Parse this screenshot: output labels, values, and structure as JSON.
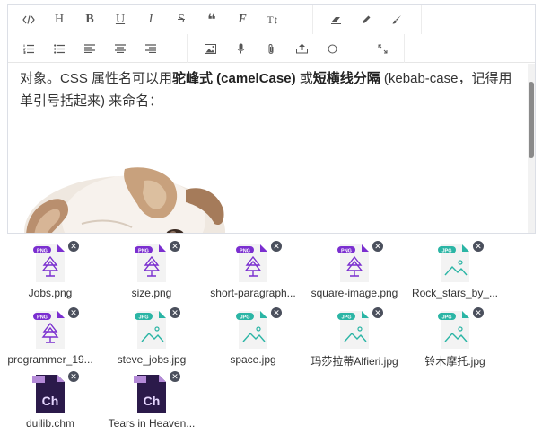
{
  "editor": {
    "toolbar_row1": [
      {
        "name": "code-icon",
        "glyph": "</>"
      },
      {
        "name": "heading-icon",
        "glyph": "H"
      },
      {
        "name": "bold-icon",
        "glyph": "B"
      },
      {
        "name": "underline-icon",
        "glyph": "U"
      },
      {
        "name": "italic-icon",
        "glyph": "I"
      },
      {
        "name": "strikethrough-icon",
        "glyph": "S"
      },
      {
        "name": "quote-icon",
        "glyph": "❝"
      },
      {
        "name": "font-family-icon",
        "glyph": "F"
      },
      {
        "name": "line-height-icon",
        "glyph": "T↕"
      },
      {
        "name": "eraser-icon",
        "glyph": ""
      },
      {
        "name": "pencil-icon",
        "glyph": ""
      },
      {
        "name": "brush-icon",
        "glyph": ""
      }
    ],
    "toolbar_row2": [
      {
        "name": "ordered-list-icon"
      },
      {
        "name": "unordered-list-icon"
      },
      {
        "name": "align-left-icon"
      },
      {
        "name": "align-center-icon"
      },
      {
        "name": "align-right-icon"
      },
      {
        "name": "image-icon"
      },
      {
        "name": "microphone-icon"
      },
      {
        "name": "attachment-icon"
      },
      {
        "name": "upload-icon"
      },
      {
        "name": "circle-icon"
      },
      {
        "name": "fullscreen-icon"
      }
    ],
    "content": {
      "text_a": "对象。CSS 属性名可以用",
      "bold_a": "驼峰式 (camelCase)",
      "text_b": " 或",
      "bold_b": "短横线分隔",
      "text_c": " (kebab-case，记得用单引号括起来) 来命名："
    }
  },
  "files": [
    {
      "name": "Jobs.png",
      "type": "PNG",
      "color": "#7b2fd0"
    },
    {
      "name": "size.png",
      "type": "PNG",
      "color": "#7b2fd0"
    },
    {
      "name": "short-paragraph...",
      "type": "PNG",
      "color": "#7b2fd0"
    },
    {
      "name": "square-image.png",
      "type": "PNG",
      "color": "#7b2fd0"
    },
    {
      "name": "Rock_stars_by_...",
      "type": "JPG",
      "color": "#2bb5a5"
    },
    {
      "name": "programmer_19...",
      "type": "PNG",
      "color": "#7b2fd0"
    },
    {
      "name": "steve_jobs.jpg",
      "type": "JPG",
      "color": "#2bb5a5"
    },
    {
      "name": "space.jpg",
      "type": "JPG",
      "color": "#2bb5a5"
    },
    {
      "name": "玛莎拉蒂Alfieri.jpg",
      "type": "JPG",
      "color": "#2bb5a5"
    },
    {
      "name": "铃木摩托.jpg",
      "type": "JPG",
      "color": "#2bb5a5"
    },
    {
      "name": "duilib.chm",
      "type": "Ch",
      "color": "#2b1a4a"
    },
    {
      "name": "Tears in Heaven...",
      "type": "Ch",
      "color": "#2b1a4a"
    }
  ],
  "remove_glyph": "✕"
}
